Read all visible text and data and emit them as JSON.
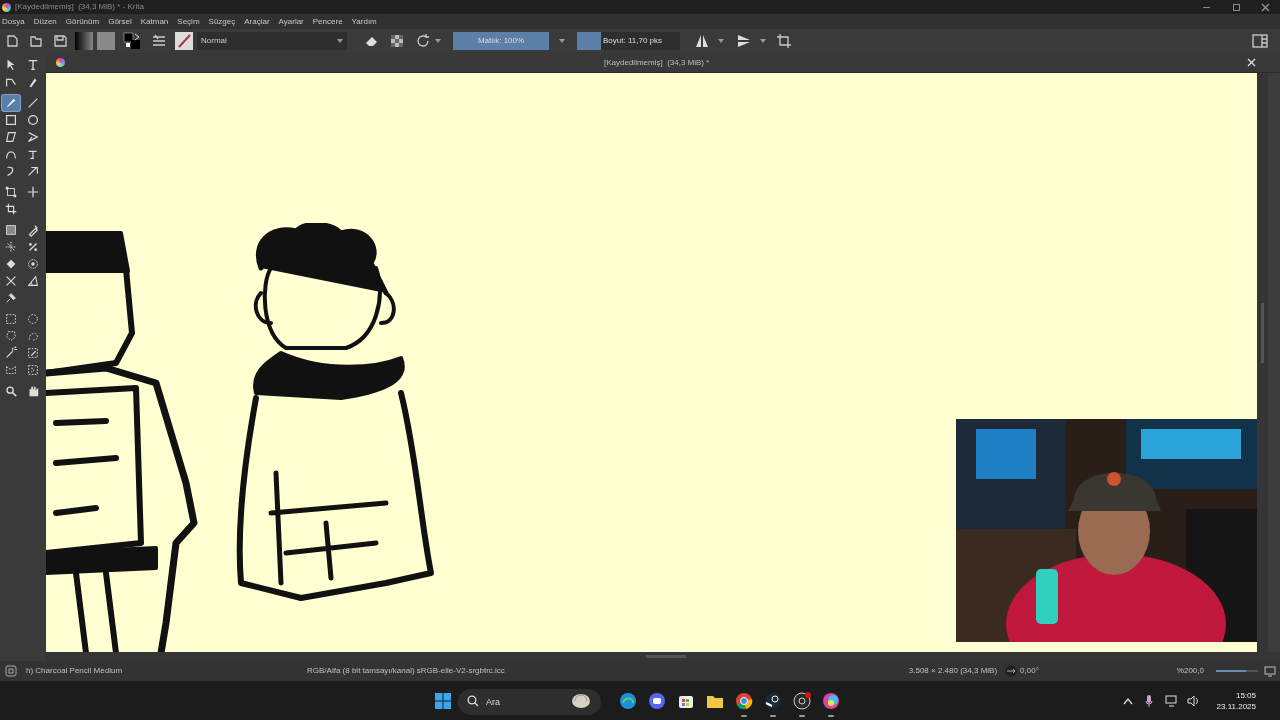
{
  "window": {
    "title": "[Kaydedilmemiş]  (34,3 MiB) * - Krita"
  },
  "menu": [
    "Dosya",
    "Düzen",
    "Görünüm",
    "Görsel",
    "Katman",
    "Seçim",
    "Süzgeç",
    "Araçlar",
    "Ayarlar",
    "Pencere",
    "Yardım"
  ],
  "toolbar": {
    "blend_mode": "Normal",
    "opacity": {
      "label": "Matlık: 100%",
      "level": 1.0
    },
    "size": {
      "label": "Boyut: 11,70 pks",
      "level": 0.23
    }
  },
  "document": {
    "title": "[Kaydedilmemiş]  (34,3 MiB) *"
  },
  "toolbox": [
    [
      {
        "kind": "select",
        "selected": false
      },
      {
        "kind": "text",
        "selected": false
      }
    ],
    [
      {
        "kind": "edit-shape",
        "selected": false
      },
      {
        "kind": "calligraphy",
        "selected": false
      }
    ],
    [
      {
        "kind": "brush",
        "selected": true
      },
      {
        "kind": "line",
        "selected": false
      }
    ],
    [
      {
        "kind": "rect",
        "selected": false
      },
      {
        "kind": "ellipse",
        "selected": false
      }
    ],
    [
      {
        "kind": "polygon",
        "selected": false
      },
      {
        "kind": "polyline",
        "selected": false
      }
    ],
    [
      {
        "kind": "bezier",
        "selected": false
      },
      {
        "kind": "freehand-path",
        "selected": false
      }
    ],
    [
      {
        "kind": "dynamic",
        "selected": false
      },
      {
        "kind": "multibrush",
        "selected": false
      }
    ],
    [
      {
        "kind": "transform",
        "selected": false
      },
      {
        "kind": "move",
        "selected": false
      }
    ],
    [
      {
        "kind": "crop",
        "selected": false
      }
    ],
    [
      {
        "kind": "gradient",
        "selected": false
      },
      {
        "kind": "picker",
        "selected": false
      }
    ],
    [
      {
        "kind": "colorize",
        "selected": false
      },
      {
        "kind": "smart-patch",
        "selected": false
      }
    ],
    [
      {
        "kind": "fill",
        "selected": false
      },
      {
        "kind": "enclose",
        "selected": false
      }
    ],
    [
      {
        "kind": "assistant",
        "selected": false
      },
      {
        "kind": "measure",
        "selected": false
      }
    ],
    [
      {
        "kind": "pin",
        "selected": false
      }
    ],
    [
      {
        "kind": "rect-select",
        "selected": false
      },
      {
        "kind": "ellipse-select",
        "selected": false
      }
    ],
    [
      {
        "kind": "poly-select",
        "selected": false
      },
      {
        "kind": "lasso-select",
        "selected": false
      }
    ],
    [
      {
        "kind": "wand-select",
        "selected": false
      },
      {
        "kind": "similar-select",
        "selected": false
      }
    ],
    [
      {
        "kind": "bezier-select",
        "selected": false
      },
      {
        "kind": "magnetic-select",
        "selected": false
      }
    ],
    [
      {
        "kind": "zoom",
        "selected": false
      },
      {
        "kind": "pan",
        "selected": false
      }
    ]
  ],
  "status_bar": {
    "brush": "h) Charcoal Pencil Medium",
    "color_profile": "RGB/Alfa (8 bit tamsayı/kanal) sRGB-elle-V2-srgbtrc.icc",
    "dimensions": "3.508 × 2.480 (34,3 MiB)",
    "rotation": "0,00°",
    "zoom": "%200,0",
    "zoom_level": {
      "level": 0.72
    }
  },
  "taskbar": {
    "search": {
      "placeholder": "Ara"
    },
    "apps": [
      {
        "kind": "edge",
        "running": false
      },
      {
        "kind": "discord",
        "running": false
      },
      {
        "kind": "store",
        "running": false
      },
      {
        "kind": "folder",
        "running": false
      },
      {
        "kind": "chrome",
        "running": true
      },
      {
        "kind": "steam",
        "running": true
      },
      {
        "kind": "obs",
        "running": true
      },
      {
        "kind": "krita",
        "running": true
      }
    ],
    "clock": {
      "time": "15:05",
      "date": "23.11.2025"
    }
  }
}
